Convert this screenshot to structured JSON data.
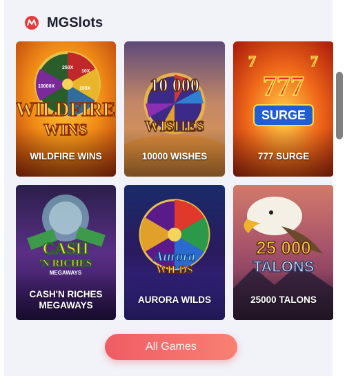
{
  "header": {
    "title": "MGSlots",
    "logo_icon": "mg-logo-icon"
  },
  "games": [
    {
      "label": "WILDFIRE WINS",
      "art_text": [
        "WILDFIRE",
        "WINS"
      ],
      "wheel_texts": [
        "250X",
        "10X",
        "100X",
        "10000X"
      ]
    },
    {
      "label": "10000 WISHES",
      "art_text": [
        "10 000",
        "WISHES"
      ]
    },
    {
      "label": "777 SURGE",
      "art_text": [
        "777",
        "SURGE"
      ]
    },
    {
      "label": "CASH'N RICHES\nMEGAWAYS",
      "art_text": [
        "CASH",
        "'N RICHES",
        "MEGAWAYS"
      ]
    },
    {
      "label": "AURORA WILDS",
      "art_text": [
        "Aurora",
        "WILDS"
      ]
    },
    {
      "label": "25000 TALONS",
      "art_text": [
        "25 000",
        "TALONS"
      ]
    }
  ],
  "footer": {
    "button_label": "All Games"
  },
  "colors": {
    "accent": "#ef5c64",
    "title": "#1b1f2d",
    "panel_bg": "#f2f2f9"
  }
}
